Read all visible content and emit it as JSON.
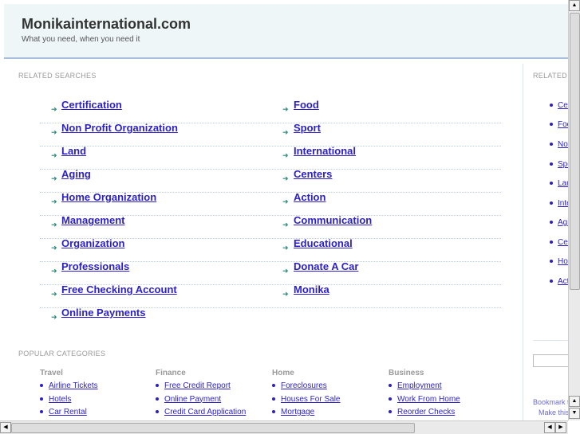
{
  "header": {
    "title": "Monikainternational.com",
    "tagline": "What you need, when you need it"
  },
  "related": {
    "heading": "RELATED SEARCHES",
    "left": [
      "Certification",
      "Non Profit Organization",
      "Land",
      "Aging",
      "Home Organization",
      "Management",
      "Organization",
      "Professionals",
      "Free Checking Account",
      "Online Payments"
    ],
    "right": [
      "Food",
      "Sport",
      "International",
      "Centers",
      "Action",
      "Communication",
      "Educational",
      "Donate A Car",
      "Monika"
    ]
  },
  "sidebar": {
    "heading": "RELATED",
    "items": [
      "Certification",
      "Food",
      "Non Profit Organization",
      "Sport",
      "Land",
      "International",
      "Aging",
      "Centers",
      "Home Organization",
      "Action"
    ],
    "bookmark": "Bookmark this page",
    "homepage": "Make this your homepage"
  },
  "popular": {
    "heading": "POPULAR CATEGORIES",
    "categories": [
      {
        "title": "Travel",
        "items": [
          "Airline Tickets",
          "Hotels",
          "Car Rental"
        ]
      },
      {
        "title": "Finance",
        "items": [
          "Free Credit Report",
          "Online Payment",
          "Credit Card Application"
        ]
      },
      {
        "title": "Home",
        "items": [
          "Foreclosures",
          "Houses For Sale",
          "Mortgage"
        ]
      },
      {
        "title": "Business",
        "items": [
          "Employment",
          "Work From Home",
          "Reorder Checks"
        ]
      }
    ]
  }
}
